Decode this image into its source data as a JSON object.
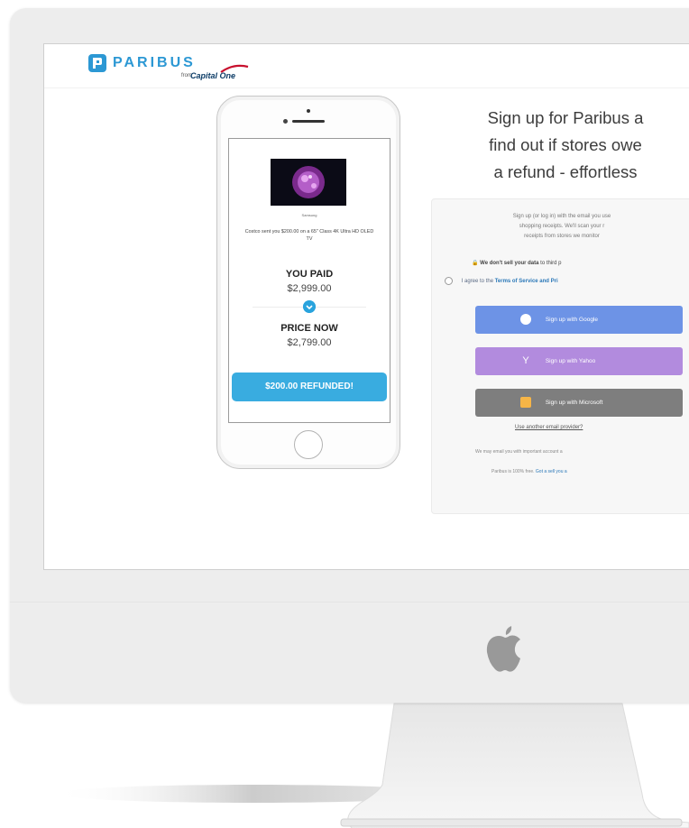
{
  "brand": {
    "name": "PARIBUS",
    "byline": "from",
    "partner": "Capital One"
  },
  "phone": {
    "product_caption": "Samsung",
    "description": "Costco sent you $200.00 on a 65\" Class 4K Ultra HD OLED TV",
    "paid_label": "YOU PAID",
    "paid_value": "$2,999.00",
    "now_label": "PRICE NOW",
    "now_value": "$2,799.00",
    "refund_label": "$200.00 REFUNDED!"
  },
  "signup": {
    "headline_lines": [
      "Sign up for Paribus a",
      "find out if stores owe",
      "a refund - effortless"
    ],
    "intro_lines": [
      "Sign up (or log in) with the email you use",
      "shopping receipts. We'll scan your r",
      "receipts from stores we monitor"
    ],
    "privacy_bold": "We don't sell your data",
    "privacy_rest": "to third p",
    "agree_prefix": "I agree to the",
    "agree_link": "Terms of Service and Pri",
    "buttons": {
      "google": "Sign up with Google",
      "yahoo": "Sign up with Yahoo",
      "microsoft": "Sign up with Microsoft"
    },
    "other_link": "Use another email provider?",
    "footer_1": "We may email you with important account a",
    "footer_2": "Paribus is 100% free.",
    "footer_2_link": "Got a sell you a"
  },
  "icons": {
    "logo": "paribus-logo-icon",
    "arrow": "arrow-down-icon",
    "google": "google-icon",
    "yahoo": "yahoo-icon",
    "microsoft": "microsoft-icon",
    "lock": "lock-icon",
    "apple": "apple-logo-icon"
  },
  "colors": {
    "brand_blue": "#2c98d4",
    "refund_blue": "#39ace0",
    "google": "#6d93e6",
    "yahoo": "#b28bde",
    "microsoft": "#7e7e7e"
  }
}
